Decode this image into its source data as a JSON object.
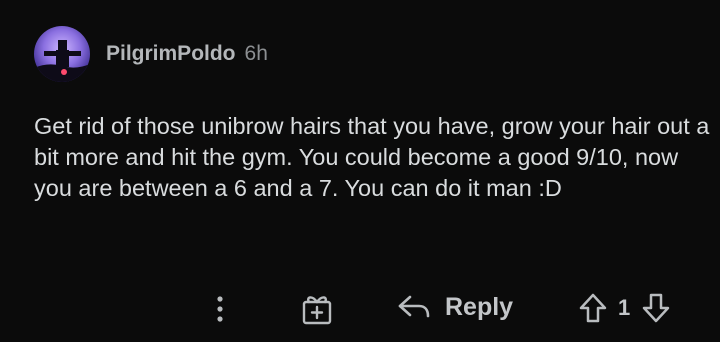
{
  "comment": {
    "author": "PilgrimPoldo",
    "age": "6h",
    "text": "Get rid of those unibrow hairs that you have, grow your hair out a bit more and hit the gym. You could become a good 9/10, now you are between a 6 and a 7. You can do it man :D"
  },
  "actions": {
    "more_icon": "vertical-ellipsis-icon",
    "award_icon": "gift-icon",
    "reply_icon": "reply-arrow-icon",
    "reply_label": "Reply",
    "upvote_icon": "upvote-arrow-icon",
    "score": "1",
    "downvote_icon": "downvote-arrow-icon"
  },
  "colors": {
    "background": "#0b0b0b",
    "text": "#d9dcde",
    "username": "#b4b7ba",
    "muted": "#8c8f92"
  }
}
